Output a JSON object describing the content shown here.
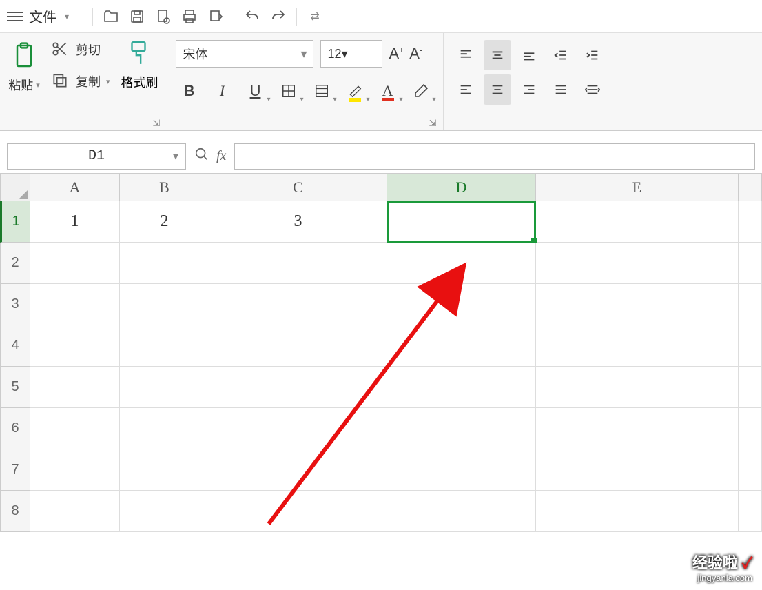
{
  "menu": {
    "file": "文件"
  },
  "clipboard": {
    "paste": "粘贴",
    "cut": "剪切",
    "copy": "复制",
    "format_painter": "格式刷"
  },
  "font": {
    "name": "宋体",
    "size": "12"
  },
  "namebox": "D1",
  "columns": [
    "A",
    "B",
    "C",
    "D",
    "E"
  ],
  "rows": [
    "1",
    "2",
    "3",
    "4",
    "5",
    "6",
    "7",
    "8"
  ],
  "cells": {
    "A1": "1",
    "B1": "2",
    "C1": "3"
  },
  "watermark": {
    "title": "经验啦",
    "check": "✓",
    "url": "jingyanla.com"
  }
}
